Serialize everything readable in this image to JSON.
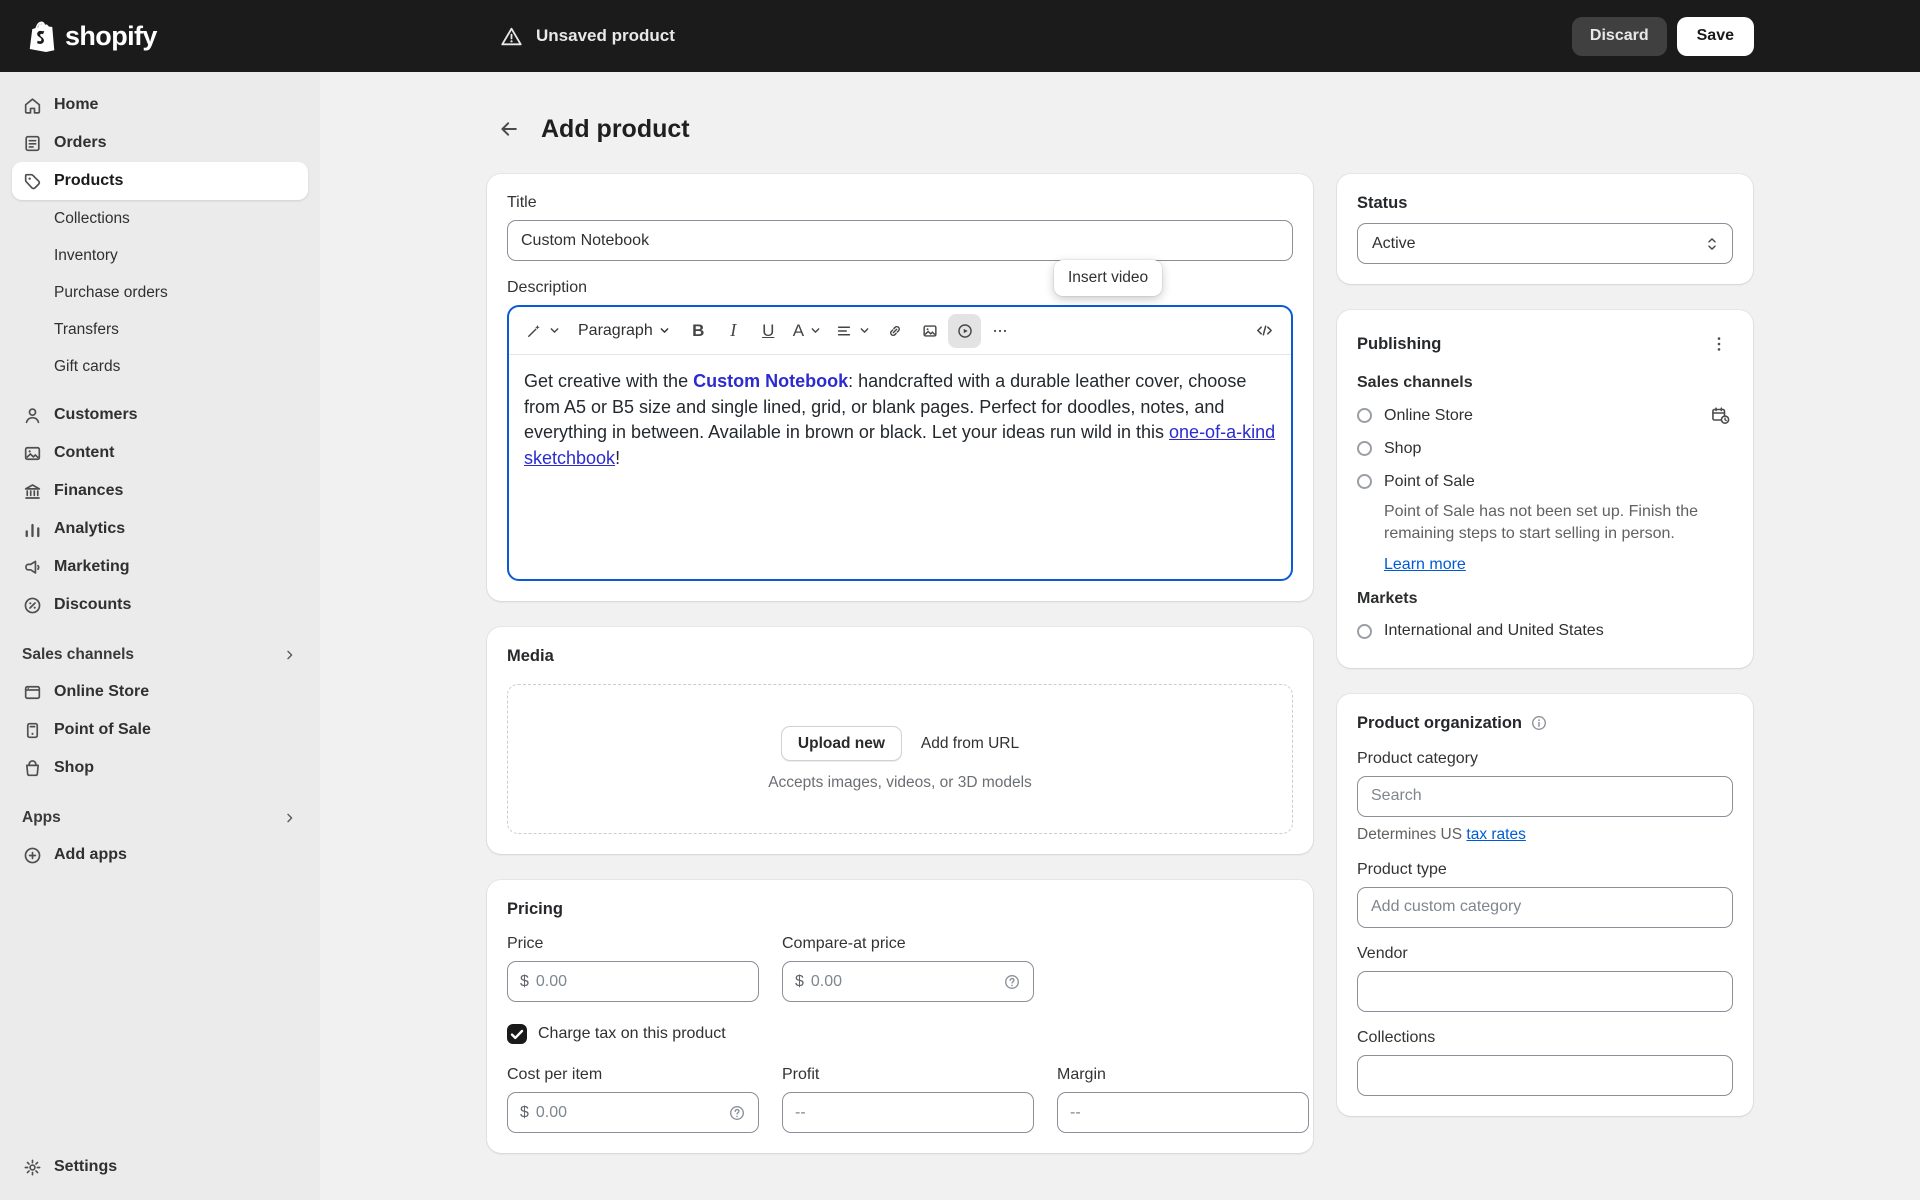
{
  "colors": {
    "topbar_bg": "#1b1b1b",
    "sidebar_bg": "#ebebeb",
    "page_bg": "#f1f1f1",
    "card_bg": "#ffffff",
    "text_primary": "#303030",
    "text_secondary": "#616161",
    "link_blue": "#005bd3",
    "editor_link_blue": "#2b2bcf",
    "focus_ring_blue": "#0a5ad6",
    "input_border": "#8a8f98"
  },
  "topbar": {
    "logo_text": "shopify",
    "unsaved_text": "Unsaved product",
    "discard_label": "Discard",
    "save_label": "Save"
  },
  "sidebar": {
    "primary": [
      {
        "label": "Home"
      },
      {
        "label": "Orders"
      },
      {
        "label": "Products"
      }
    ],
    "products_subitems": [
      {
        "label": "Collections"
      },
      {
        "label": "Inventory"
      },
      {
        "label": "Purchase orders"
      },
      {
        "label": "Transfers"
      },
      {
        "label": "Gift cards"
      }
    ],
    "secondary": [
      {
        "label": "Customers"
      },
      {
        "label": "Content"
      },
      {
        "label": "Finances"
      },
      {
        "label": "Analytics"
      },
      {
        "label": "Marketing"
      },
      {
        "label": "Discounts"
      }
    ],
    "sales_channels": {
      "header": "Sales channels",
      "items": [
        {
          "label": "Online Store"
        },
        {
          "label": "Point of Sale"
        },
        {
          "label": "Shop"
        }
      ]
    },
    "apps": {
      "header": "Apps",
      "items": [
        {
          "label": "Add apps"
        }
      ]
    },
    "settings_label": "Settings"
  },
  "page": {
    "title": "Add product"
  },
  "details": {
    "title_label": "Title",
    "title_value": "Custom Notebook",
    "description_label": "Description",
    "toolbar": {
      "style_selector": "Paragraph",
      "bold": "B",
      "italic": "I",
      "underline": "U",
      "text_color": "A",
      "tooltip": "Insert video"
    },
    "description": {
      "part1": "Get creative with the ",
      "bold_link": "Custom Notebook",
      "part2": ": handcrafted with a durable leather cover, choose from A5 or B5 size and single lined, grid, or blank pages. Perfect for doodles, notes, and everything in between. Available in brown or black. Let your ideas run wild in this ",
      "link": "one-of-a-kind sketchbook",
      "part3": "!"
    }
  },
  "media": {
    "title": "Media",
    "upload_button": "Upload new",
    "add_from_url": "Add from URL",
    "hint": "Accepts images, videos, or 3D models"
  },
  "pricing": {
    "title": "Pricing",
    "price_label": "Price",
    "compare_at_label": "Compare-at price",
    "currency_symbol": "$",
    "amount_placeholder": "0.00",
    "charge_tax_label": "Charge tax on this product",
    "charge_tax_checked": true,
    "cost_label": "Cost per item",
    "profit_label": "Profit",
    "margin_label": "Margin",
    "empty_placeholder": "--"
  },
  "status_card": {
    "title": "Status",
    "value": "Active"
  },
  "publishing": {
    "title": "Publishing",
    "sales_channels_heading": "Sales channels",
    "channels": [
      {
        "label": "Online Store"
      },
      {
        "label": "Shop"
      },
      {
        "label": "Point of Sale"
      }
    ],
    "pos_note": "Point of Sale has not been set up. Finish the remaining steps to start selling in person.",
    "learn_more": "Learn more",
    "markets_heading": "Markets",
    "markets": [
      {
        "label": "International and United States"
      }
    ]
  },
  "organization": {
    "title": "Product organization",
    "category_label": "Product category",
    "category_placeholder": "Search",
    "tax_note_prefix": "Determines US ",
    "tax_note_link": "tax rates",
    "type_label": "Product type",
    "type_placeholder": "Add custom category",
    "vendor_label": "Vendor",
    "collections_label": "Collections"
  }
}
